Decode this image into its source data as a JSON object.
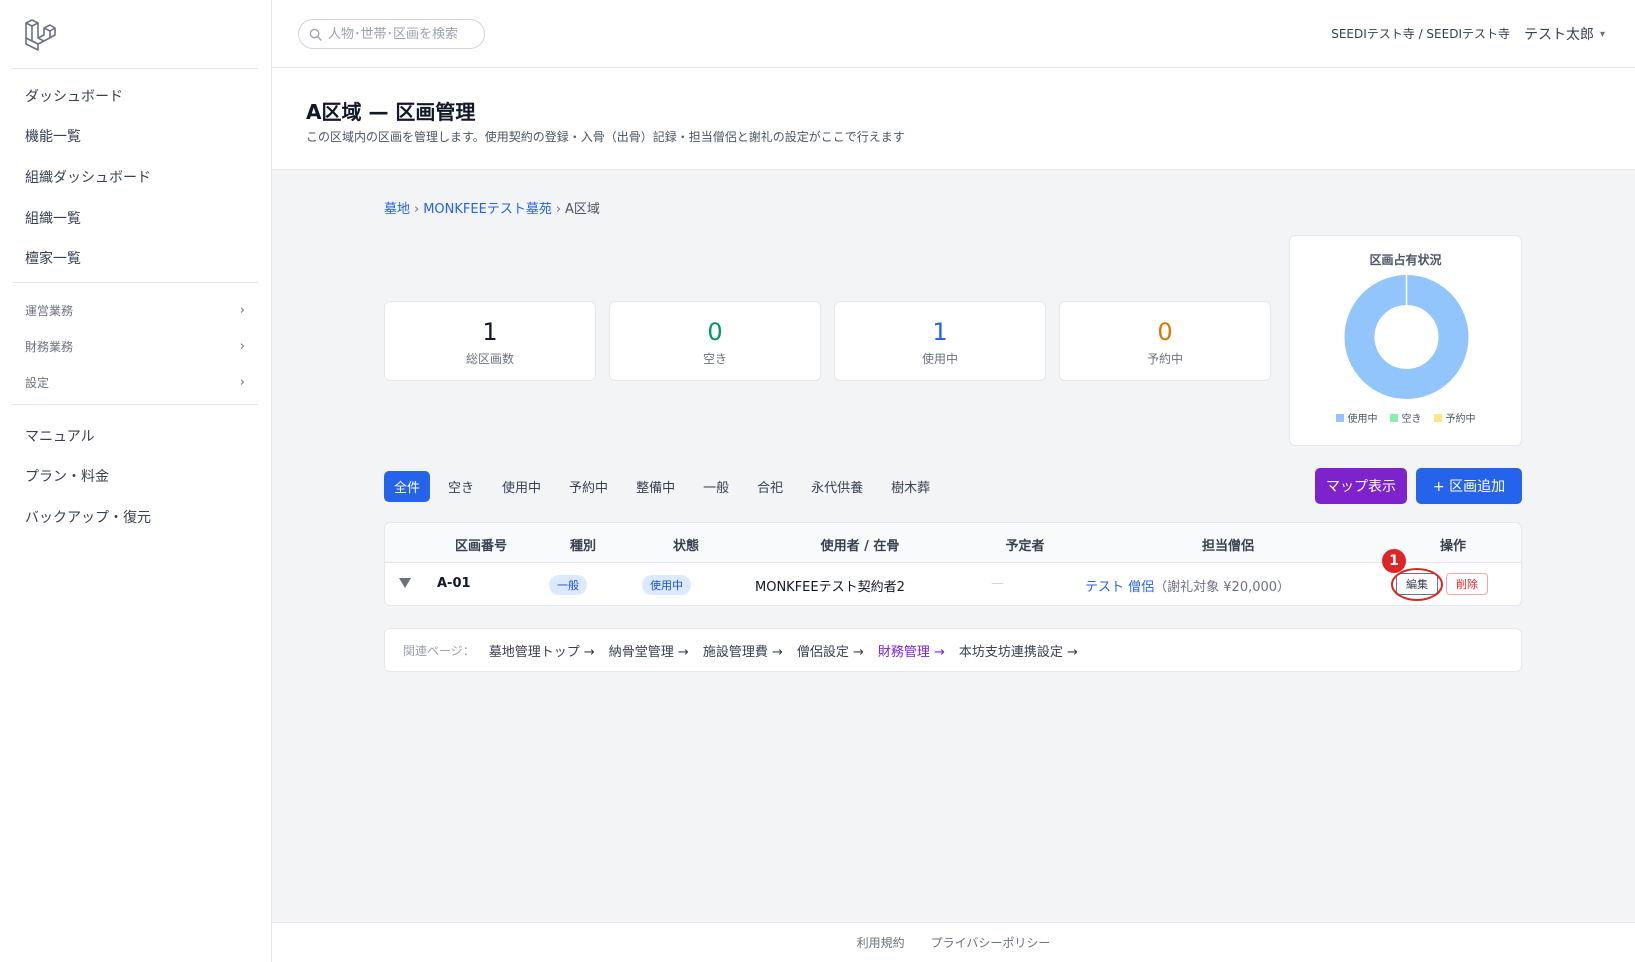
{
  "sidebar": {
    "items_top": [
      {
        "label": "ダッシュボード"
      },
      {
        "label": "機能一覧"
      },
      {
        "label": "組織ダッシュボード"
      },
      {
        "label": "組織一覧"
      },
      {
        "label": "檀家一覧"
      }
    ],
    "groups": [
      {
        "label": "運営業務"
      },
      {
        "label": "財務業務"
      },
      {
        "label": "設定"
      }
    ],
    "items_bottom": [
      {
        "label": "マニュアル"
      },
      {
        "label": "プラン・料金"
      },
      {
        "label": "バックアップ・復元"
      }
    ]
  },
  "topbar": {
    "search_placeholder": "人物･世帯･区画を検索",
    "tenant": "SEEDIテスト寺 / SEEDIテスト寺",
    "user": "テスト太郎"
  },
  "header": {
    "title": "A区域 — 区画管理",
    "subtitle": "この区域内の区画を管理します。使用契約の登録・入骨（出骨）記録・担当僧侶と謝礼の設定がここで行えます"
  },
  "breadcrumb": {
    "items": [
      "墓地",
      "MONKFEEテスト墓苑"
    ],
    "current": "A区域"
  },
  "stats": [
    {
      "value": "1",
      "label": "総区画数",
      "color": "#111827"
    },
    {
      "value": "0",
      "label": "空き",
      "color": "#059669"
    },
    {
      "value": "1",
      "label": "使用中",
      "color": "#2563eb"
    },
    {
      "value": "0",
      "label": "予約中",
      "color": "#d97706"
    }
  ],
  "chart_data": {
    "type": "pie",
    "title": "区画占有状況",
    "categories": [
      "使用中",
      "空き",
      "予約中"
    ],
    "values": [
      1,
      0,
      0
    ],
    "colors": [
      "#93c5fd",
      "#86efac",
      "#fde68a"
    ],
    "legend": "bottom"
  },
  "filters": {
    "tabs": [
      "全件",
      "空き",
      "使用中",
      "予約中",
      "整備中",
      "一般",
      "合祀",
      "永代供養",
      "樹木葬"
    ],
    "active": 0
  },
  "actions": {
    "map": "マップ表示",
    "add": "+ 区画追加"
  },
  "table": {
    "headers": [
      "区画番号",
      "種別",
      "状態",
      "使用者 / 在骨",
      "予定者",
      "担当僧侶",
      "操作"
    ],
    "rows": [
      {
        "plot": "A-01",
        "type": "一般",
        "status": "使用中",
        "user": "MONKFEEテスト契約者2",
        "planned": "—",
        "monk": "テスト 僧侶",
        "monk_note": "（謝礼対象 ¥20,000）",
        "edit": "編集",
        "delete": "削除"
      }
    ],
    "step_marker": "1"
  },
  "related": {
    "label": "関連ページ：",
    "links": [
      "墓地管理トップ →",
      "納骨堂管理 →",
      "施設管理費 →",
      "僧侶設定 →",
      "財務管理 →",
      "本坊支坊連携設定 →"
    ]
  },
  "footer": {
    "links": [
      "利用規約",
      "プライバシーポリシー"
    ]
  }
}
